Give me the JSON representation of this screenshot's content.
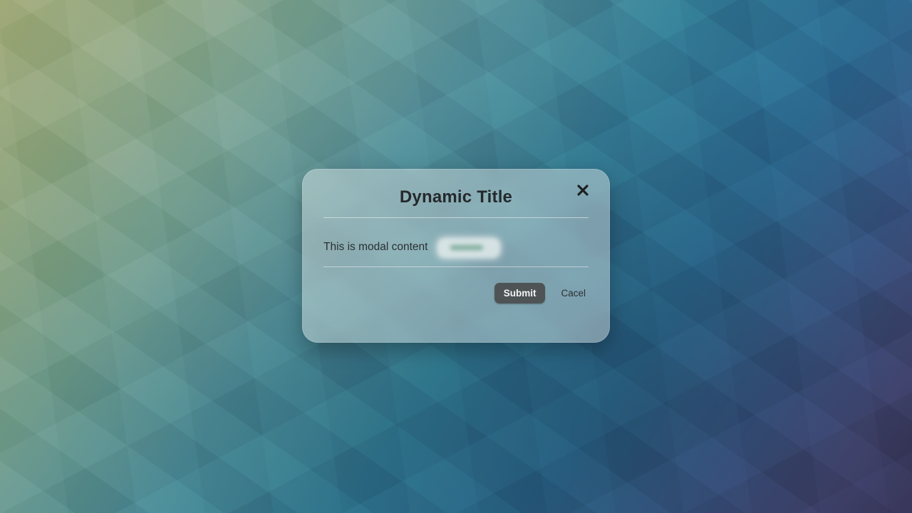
{
  "modal": {
    "title": "Dynamic Title",
    "content": "This is modal content",
    "submit_label": "Submit",
    "cancel_label": "Cacel"
  }
}
